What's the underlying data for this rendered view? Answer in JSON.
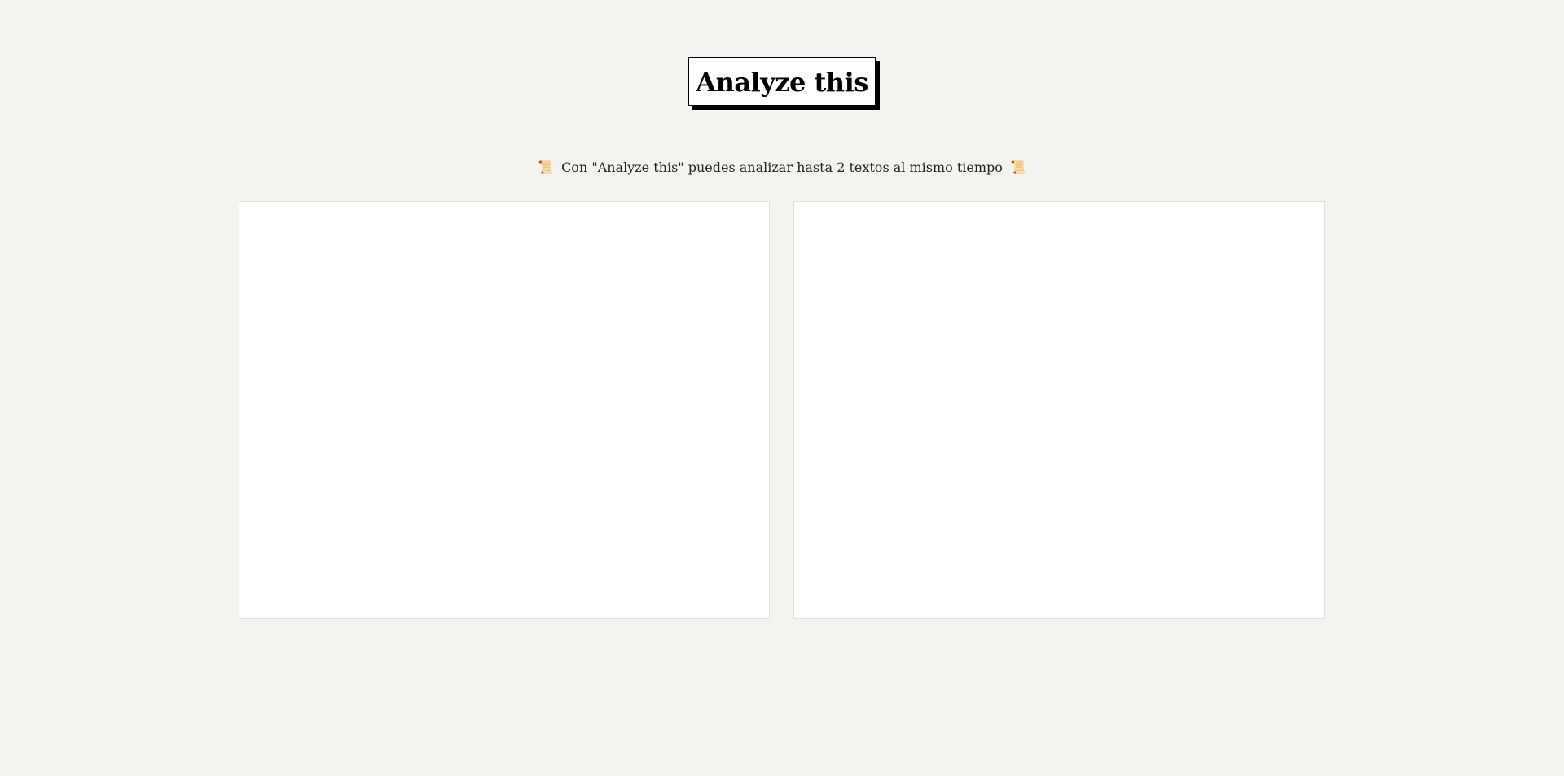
{
  "header": {
    "title": "Analyze this"
  },
  "subtitle": {
    "icon_left": "📜",
    "text": "Con \"Analyze this\" puedes analizar hasta 2 textos al mismo tiempo",
    "icon_right": "📜",
    "icon_name": "scroll-icon"
  },
  "panels": [
    {
      "value": "",
      "placeholder": ""
    },
    {
      "value": "",
      "placeholder": ""
    }
  ],
  "colors": {
    "background": "#f3f3ef",
    "panel_background": "#ffffff",
    "panel_border": "#e2e2dc",
    "title_border": "#000000"
  }
}
